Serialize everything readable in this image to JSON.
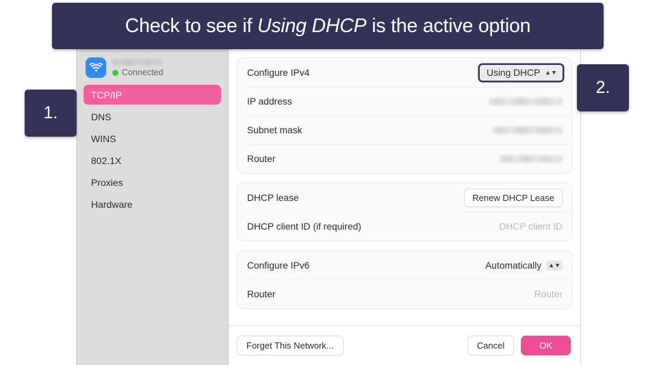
{
  "banner": {
    "prefix": "Check to see if ",
    "emphasis": "Using DHCP",
    "suffix": " is the active option"
  },
  "badges": {
    "one": "1.",
    "two": "2."
  },
  "sidebar": {
    "network_status": "Connected",
    "ssid_redacted": true,
    "items": [
      {
        "label": "TCP/IP",
        "selected": true
      },
      {
        "label": "DNS",
        "selected": false
      },
      {
        "label": "WINS",
        "selected": false
      },
      {
        "label": "802.1X",
        "selected": false
      },
      {
        "label": "Proxies",
        "selected": false
      },
      {
        "label": "Hardware",
        "selected": false
      }
    ]
  },
  "ipv4_card": {
    "configure_label": "Configure IPv4",
    "configure_value": "Using DHCP",
    "ip_label": "IP address",
    "subnet_label": "Subnet mask",
    "router_label": "Router"
  },
  "dhcp_card": {
    "lease_label": "DHCP lease",
    "renew_button": "Renew DHCP Lease",
    "client_id_label": "DHCP client ID (if required)",
    "client_id_placeholder": "DHCP client ID"
  },
  "ipv6_card": {
    "configure_label": "Configure IPv6",
    "configure_value": "Automatically",
    "router_label": "Router",
    "router_placeholder": "Router"
  },
  "footer": {
    "forget_label": "Forget This Network...",
    "cancel_label": "Cancel",
    "ok_label": "OK"
  },
  "colors": {
    "accent_navy": "#333359",
    "accent_pink": "#ef4d96",
    "selected_pink": "#f0609f",
    "status_green": "#3cc93c",
    "wifi_blue": "#2f8cf7"
  }
}
